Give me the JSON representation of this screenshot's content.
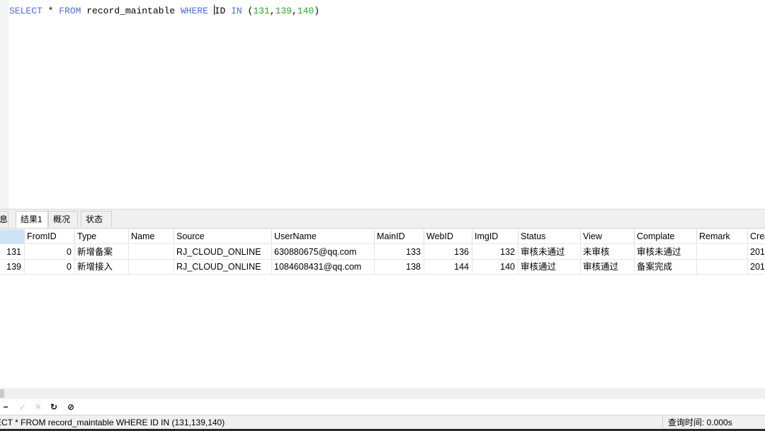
{
  "editor": {
    "sql_tokens": {
      "select": "SELECT",
      "star": " * ",
      "from": "FROM",
      "table": " record_maintable ",
      "where": "WHERE",
      "space": " ",
      "id": "ID",
      "in": "IN",
      "lparen": " (",
      "n1": "131",
      "c1": ",",
      "n2": "139",
      "c2": ",",
      "n3": "140",
      "rparen": ")"
    }
  },
  "tabs": [
    {
      "label": "息"
    },
    {
      "label": "结果1"
    },
    {
      "label": "概况"
    },
    {
      "label": "状态"
    }
  ],
  "grid": {
    "columns": [
      "",
      "FromID",
      "Type",
      "Name",
      "Source",
      "UserName",
      "MainID",
      "WebID",
      "ImgID",
      "Status",
      "View",
      "Complate",
      "Remark",
      "Crea"
    ],
    "rows": [
      [
        "131",
        "0",
        "新增备案",
        "",
        "RJ_CLOUD_ONLINE",
        "630880675@qq.com",
        "133",
        "136",
        "132",
        "审核未通过",
        "未审核",
        "审核未通过",
        "",
        "201"
      ],
      [
        "139",
        "0",
        "新增接入",
        "",
        "RJ_CLOUD_ONLINE",
        "1084608431@qq.com",
        "138",
        "144",
        "140",
        "审核通过",
        "审核通过",
        "备案完成",
        "",
        "201"
      ]
    ]
  },
  "toolbar": {
    "minus": "−",
    "check": "✓",
    "cross": "✕",
    "refresh": "↻",
    "stop": "⊘"
  },
  "status": {
    "sql": "ECT * FROM record_maintable WHERE ID IN (131,139,140)",
    "time": "查询时间: 0.000s"
  },
  "colors": {
    "keyword": "#4a6fd8",
    "number": "#2aa52a",
    "header_selected": "#cfe3f7"
  }
}
